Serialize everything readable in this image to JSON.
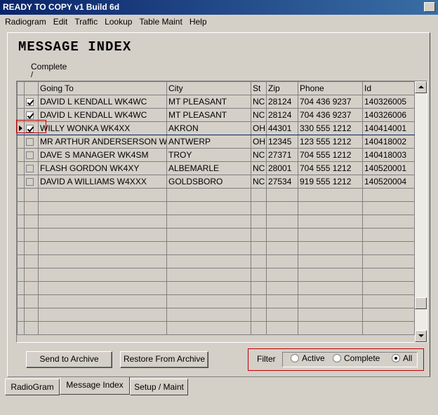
{
  "window": {
    "title": "READY TO COPY v1 Build 6d"
  },
  "menu": [
    {
      "label": "Radiogram"
    },
    {
      "label": "Edit"
    },
    {
      "label": "Traffic"
    },
    {
      "label": "Lookup"
    },
    {
      "label": "Table Maint"
    },
    {
      "label": "Help"
    }
  ],
  "page": {
    "title": "MESSAGE INDEX",
    "complete_header": "Complete",
    "complete_slash": "/"
  },
  "grid": {
    "columns": [
      "Going To",
      "City",
      "St",
      "Zip",
      "Phone",
      "Id"
    ],
    "rows": [
      {
        "complete": true,
        "going_to": "DAVID L KENDALL WK4WC",
        "city": "MT PLEASANT",
        "st": "NC",
        "zip": "28124",
        "phone": "704 436 9237",
        "id": "140326005"
      },
      {
        "complete": true,
        "going_to": "DAVID L KENDALL WK4WC",
        "city": "MT PLEASANT",
        "st": "NC",
        "zip": "28124",
        "phone": "704 436 9237",
        "id": "140326006"
      },
      {
        "complete": true,
        "going_to": "WILLY WONKA WK4XX",
        "city": "AKRON",
        "st": "OH",
        "zip": "44301",
        "phone": "330 555 1212",
        "id": "140414001"
      },
      {
        "complete": false,
        "going_to": "MR ARTHUR ANDERSERSON W",
        "city": "ANTWERP",
        "st": "OH",
        "zip": "12345",
        "phone": "123 555 1212",
        "id": "140418002"
      },
      {
        "complete": false,
        "going_to": "DAVE S MANAGER WK4SM",
        "city": "TROY",
        "st": "NC",
        "zip": "27371",
        "phone": "704 555 1212",
        "id": "140418003"
      },
      {
        "complete": false,
        "going_to": "FLASH GORDON WK4XY",
        "city": "ALBEMARLE",
        "st": "NC",
        "zip": "28001",
        "phone": "704 555 1212",
        "id": "140520001"
      },
      {
        "complete": false,
        "going_to": "DAVID A WILLIAMS W4XXX",
        "city": "GOLDSBORO",
        "st": "NC",
        "zip": "27534",
        "phone": "919 555 1212",
        "id": "140520004"
      }
    ],
    "current_row": 2
  },
  "buttons": {
    "send_archive": "Send to Archive",
    "restore_archive": "Restore From Archive"
  },
  "filter": {
    "label": "Filter",
    "options": [
      "Active",
      "Complete",
      "All"
    ],
    "selected": "All"
  },
  "tabs": [
    {
      "label": "RadioGram"
    },
    {
      "label": "Message Index"
    },
    {
      "label": "Setup / Maint"
    }
  ],
  "colors": {
    "titlebar_start": "#0a246a",
    "titlebar_end": "#3a6ea5",
    "highlight_outline": "#c00000",
    "face": "#d4d0c8"
  }
}
